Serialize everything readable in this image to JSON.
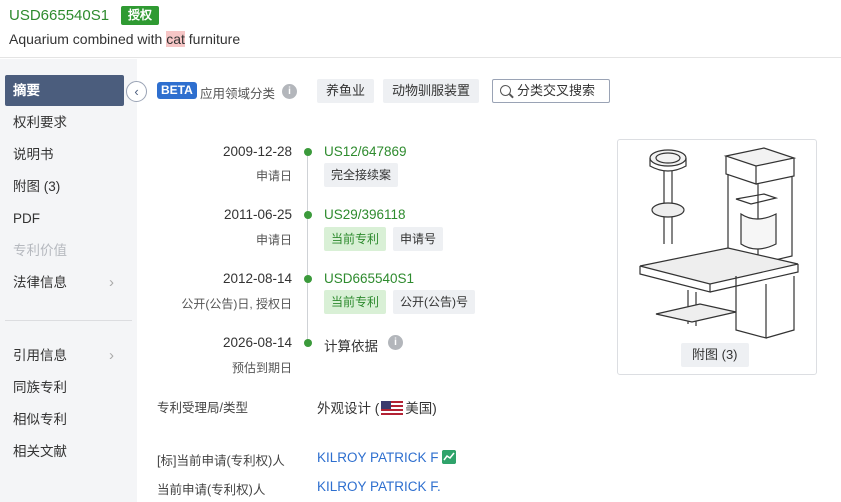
{
  "header": {
    "publication_number": "USD665540S1",
    "status": "授权",
    "title_before": "Aquarium combined with ",
    "title_highlight": "cat",
    "title_after": " furniture"
  },
  "sidebar": {
    "items": [
      {
        "label": "摘要",
        "state": "active"
      },
      {
        "label": "权利要求"
      },
      {
        "label": "说明书"
      },
      {
        "label": "附图 (3)"
      },
      {
        "label": "PDF"
      },
      {
        "label": "专利价值",
        "state": "disabled"
      },
      {
        "label": "法律信息",
        "has_arrow": true
      },
      {
        "label": "引用信息",
        "has_arrow": true
      },
      {
        "label": "同族专利"
      },
      {
        "label": "相似专利"
      },
      {
        "label": "相关文献"
      }
    ],
    "collapse_icon": "chevron-left-icon"
  },
  "classification": {
    "beta_label": "BETA",
    "label": "应用领域分类",
    "tags": [
      "养鱼业",
      "动物驯服装置"
    ],
    "search_button": "分类交叉搜索"
  },
  "timeline": [
    {
      "date": "2009-12-28",
      "sub": "申请日",
      "value": "US12/647869",
      "chips": [
        {
          "label": "完全接续案",
          "style": "gray"
        }
      ]
    },
    {
      "date": "2011-06-25",
      "sub": "申请日",
      "value": "US29/396118",
      "chips": [
        {
          "label": "当前专利",
          "style": "green"
        },
        {
          "label": "申请号",
          "style": "gray"
        }
      ]
    },
    {
      "date": "2012-08-14",
      "sub": "公开(公告)日, 授权日",
      "value": "USD665540S1",
      "chips": [
        {
          "label": "当前专利",
          "style": "green"
        },
        {
          "label": "公开(公告)号",
          "style": "gray"
        }
      ]
    },
    {
      "date": "2026-08-14",
      "sub": "预估到期日",
      "value": "计算依据"
    }
  ],
  "figure": {
    "button_label": "附图 (3)"
  },
  "details": {
    "office_type_label": "专利受理局/类型",
    "office_type_value": "外观设计 (",
    "country": "美国)",
    "standard_applicant_label": "[标]当前申请(专利权)人",
    "standard_applicant_value": "KILROY PATRICK F",
    "current_applicant_label": "当前申请(专利权)人",
    "current_applicant_value": "KILROY PATRICK F."
  },
  "colors": {
    "accent_green": "#2f9a32",
    "sidebar_active": "#4b5d7d",
    "link_blue": "#2e6fcf"
  }
}
